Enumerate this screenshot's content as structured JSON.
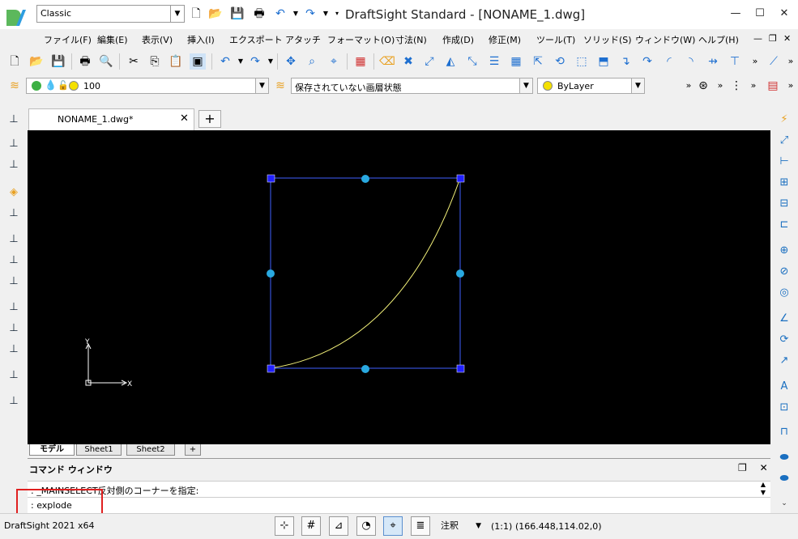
{
  "titlebar": {
    "workspace": "Classic",
    "title": "DraftSight Standard - [NONAME_1.dwg]",
    "minimize": "—",
    "maximize": "☐",
    "close": "✕"
  },
  "menu": {
    "items": [
      "ファイル(F)",
      "編集(E)",
      "表示(V)",
      "挿入(I)",
      "エクスポート",
      "アタッチ",
      "フォーマット(O)",
      "寸法(N)",
      "作成(D)",
      "修正(M)",
      "ツール(T)",
      "ソリッド(S)",
      "ウィンドウ(W)",
      "ヘルプ(H)"
    ],
    "doc_min": "—",
    "doc_restore": "❐",
    "doc_close": "✕"
  },
  "properties": {
    "layer_value": "100",
    "layer_state": "保存されていない画層状態",
    "color": "ByLayer"
  },
  "document": {
    "tab_label": "NONAME_1.dwg*",
    "tab_close": "✕",
    "add_tab": "+"
  },
  "canvas": {
    "ucs_x": "X",
    "ucs_y": "Y"
  },
  "layout_tabs": [
    "モデル",
    "Sheet1",
    "Sheet2",
    "+"
  ],
  "command": {
    "title": "コマンド ウィンドウ",
    "history": ": _MAINSELECT反対側のコーナーを指定:",
    "input": ": explode",
    "restore": "❐",
    "close": "✕"
  },
  "status": {
    "product": "DraftSight 2021 x64",
    "annotation": "注釈",
    "scale": "(1:1)",
    "coords": "(166.448,114.02,0)"
  },
  "colors": {
    "accent": "#1e6fd0",
    "selection_box": "#4060ff",
    "grip": "#29a9e0",
    "curve": "#f4f27a",
    "highlight": "#e02020"
  }
}
